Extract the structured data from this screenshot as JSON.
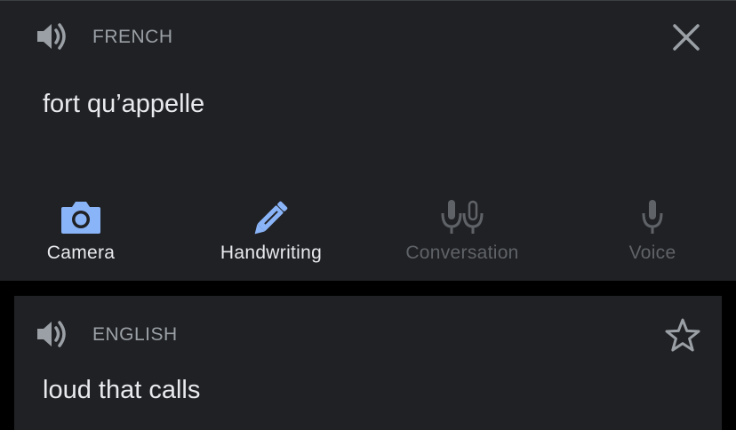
{
  "source": {
    "language": "FRENCH",
    "text": "fort qu’appelle"
  },
  "tools": [
    {
      "label": "Camera",
      "icon": "camera-icon",
      "state": "active"
    },
    {
      "label": "Handwriting",
      "icon": "pen-icon",
      "state": "active"
    },
    {
      "label": "Conversation",
      "icon": "two-microphones-icon",
      "state": "disabled"
    },
    {
      "label": "Voice",
      "icon": "microphone-icon",
      "state": "disabled"
    }
  ],
  "result": {
    "language": "ENGLISH",
    "text": "loud that calls"
  },
  "colors": {
    "panel_bg": "#202124",
    "page_bg": "#000000",
    "accent_blue": "#8ab4f8",
    "text_primary": "#e8eaed",
    "text_secondary": "#9aa0a6",
    "disabled": "#5f6368"
  }
}
